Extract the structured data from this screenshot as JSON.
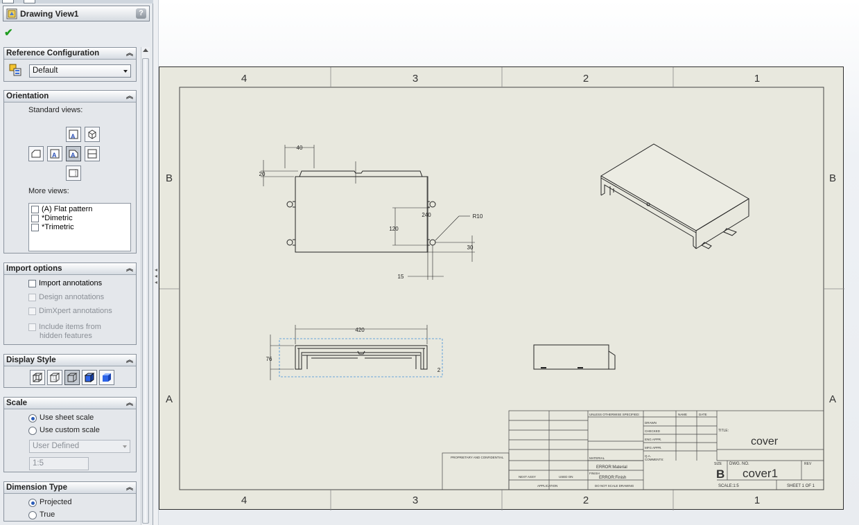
{
  "property_manager": {
    "title": "Drawing View1",
    "help": "?"
  },
  "reference_configuration": {
    "header": "Reference Configuration",
    "collapse_glyph": "⌃⌃",
    "value": "Default"
  },
  "orientation": {
    "header": "Orientation",
    "standard_views_label": "Standard views:",
    "more_views_label": "More views:",
    "more_views": [
      "(A) Flat pattern",
      "*Dimetric",
      "*Trimetric"
    ]
  },
  "import_options": {
    "header": "Import options",
    "items": [
      "Import annotations",
      "Design annotations",
      "DimXpert annotations",
      "Include items from",
      "hidden features"
    ]
  },
  "display_style": {
    "header": "Display Style"
  },
  "scale": {
    "header": "Scale",
    "use_sheet_scale": "Use sheet scale",
    "use_custom_scale": "Use custom scale",
    "dropdown": "User Defined",
    "ratio": "1:5"
  },
  "dimension_type": {
    "header": "Dimension Type",
    "projected": "Projected",
    "true": "True"
  },
  "sheet": {
    "zones_top": [
      "4",
      "3",
      "2",
      "1"
    ],
    "zones_side": [
      "B",
      "A"
    ],
    "dims": {
      "d40": "40",
      "d20": "20",
      "d240": "240",
      "d120": "120",
      "d30": "30",
      "d15": "15",
      "r10": "R10",
      "d420": "420",
      "d76": "76",
      "d2": "2"
    },
    "title_block": {
      "part_name": "cover",
      "dwg_no_label": "DWG. NO.",
      "dwg_no": "cover1",
      "size_label": "SIZE",
      "size": "B",
      "rev_label": "REV",
      "scale": "SCALE:1:5",
      "sheet": "SHEET 1 OF 1",
      "material_error": "ERROR:Material",
      "finish_error": "ERROR:Finish",
      "name_label": "NAME",
      "date_label": "DATE",
      "drawn": "DRAWN",
      "checked": "CHECKED",
      "eng_appr": "ENG APPR.",
      "mfg_appr": "MFG APPR.",
      "qa": "Q.A.",
      "comments": "COMMENTS:",
      "title_label": "TITLE:",
      "unless": "UNLESS OTHERWISE SPECIFIED:",
      "next_assy": "NEXT ASSY",
      "used_on": "USED ON",
      "application": "APPLICATION",
      "do_not_scale": "DO NOT SCALE DRAWING",
      "proprietary": "PROPRIETARY AND CONFIDENTIAL",
      "material_label": "MATERIAL",
      "finish_label": "FINISH"
    }
  }
}
